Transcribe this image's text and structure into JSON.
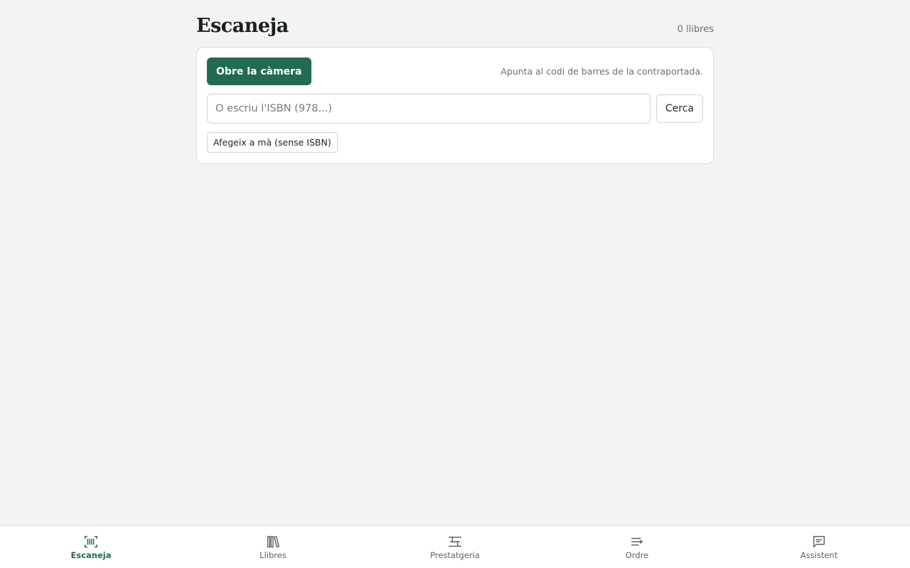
{
  "header": {
    "title": "Escaneja",
    "count": "0 llibres"
  },
  "scan": {
    "camera_label": "Obre la càmera",
    "hint": "Apunta al codi de barres de la contraportada.",
    "isbn_placeholder": "O escriu l'ISBN (978...)",
    "isbn_value": "",
    "search_label": "Cerca",
    "manual_label": "Afegeix a mà (sense ISBN)"
  },
  "nav": {
    "items": [
      {
        "label": "Escaneja",
        "icon": "barcode-scan-icon",
        "active": true
      },
      {
        "label": "Llibres",
        "icon": "books-icon",
        "active": false
      },
      {
        "label": "Prestatgeria",
        "icon": "shelf-icon",
        "active": false
      },
      {
        "label": "Ordre",
        "icon": "sort-icon",
        "active": false
      },
      {
        "label": "Assistent",
        "icon": "chat-icon",
        "active": false
      }
    ]
  },
  "colors": {
    "accent": "#236a55",
    "background": "#f3f4f1"
  }
}
